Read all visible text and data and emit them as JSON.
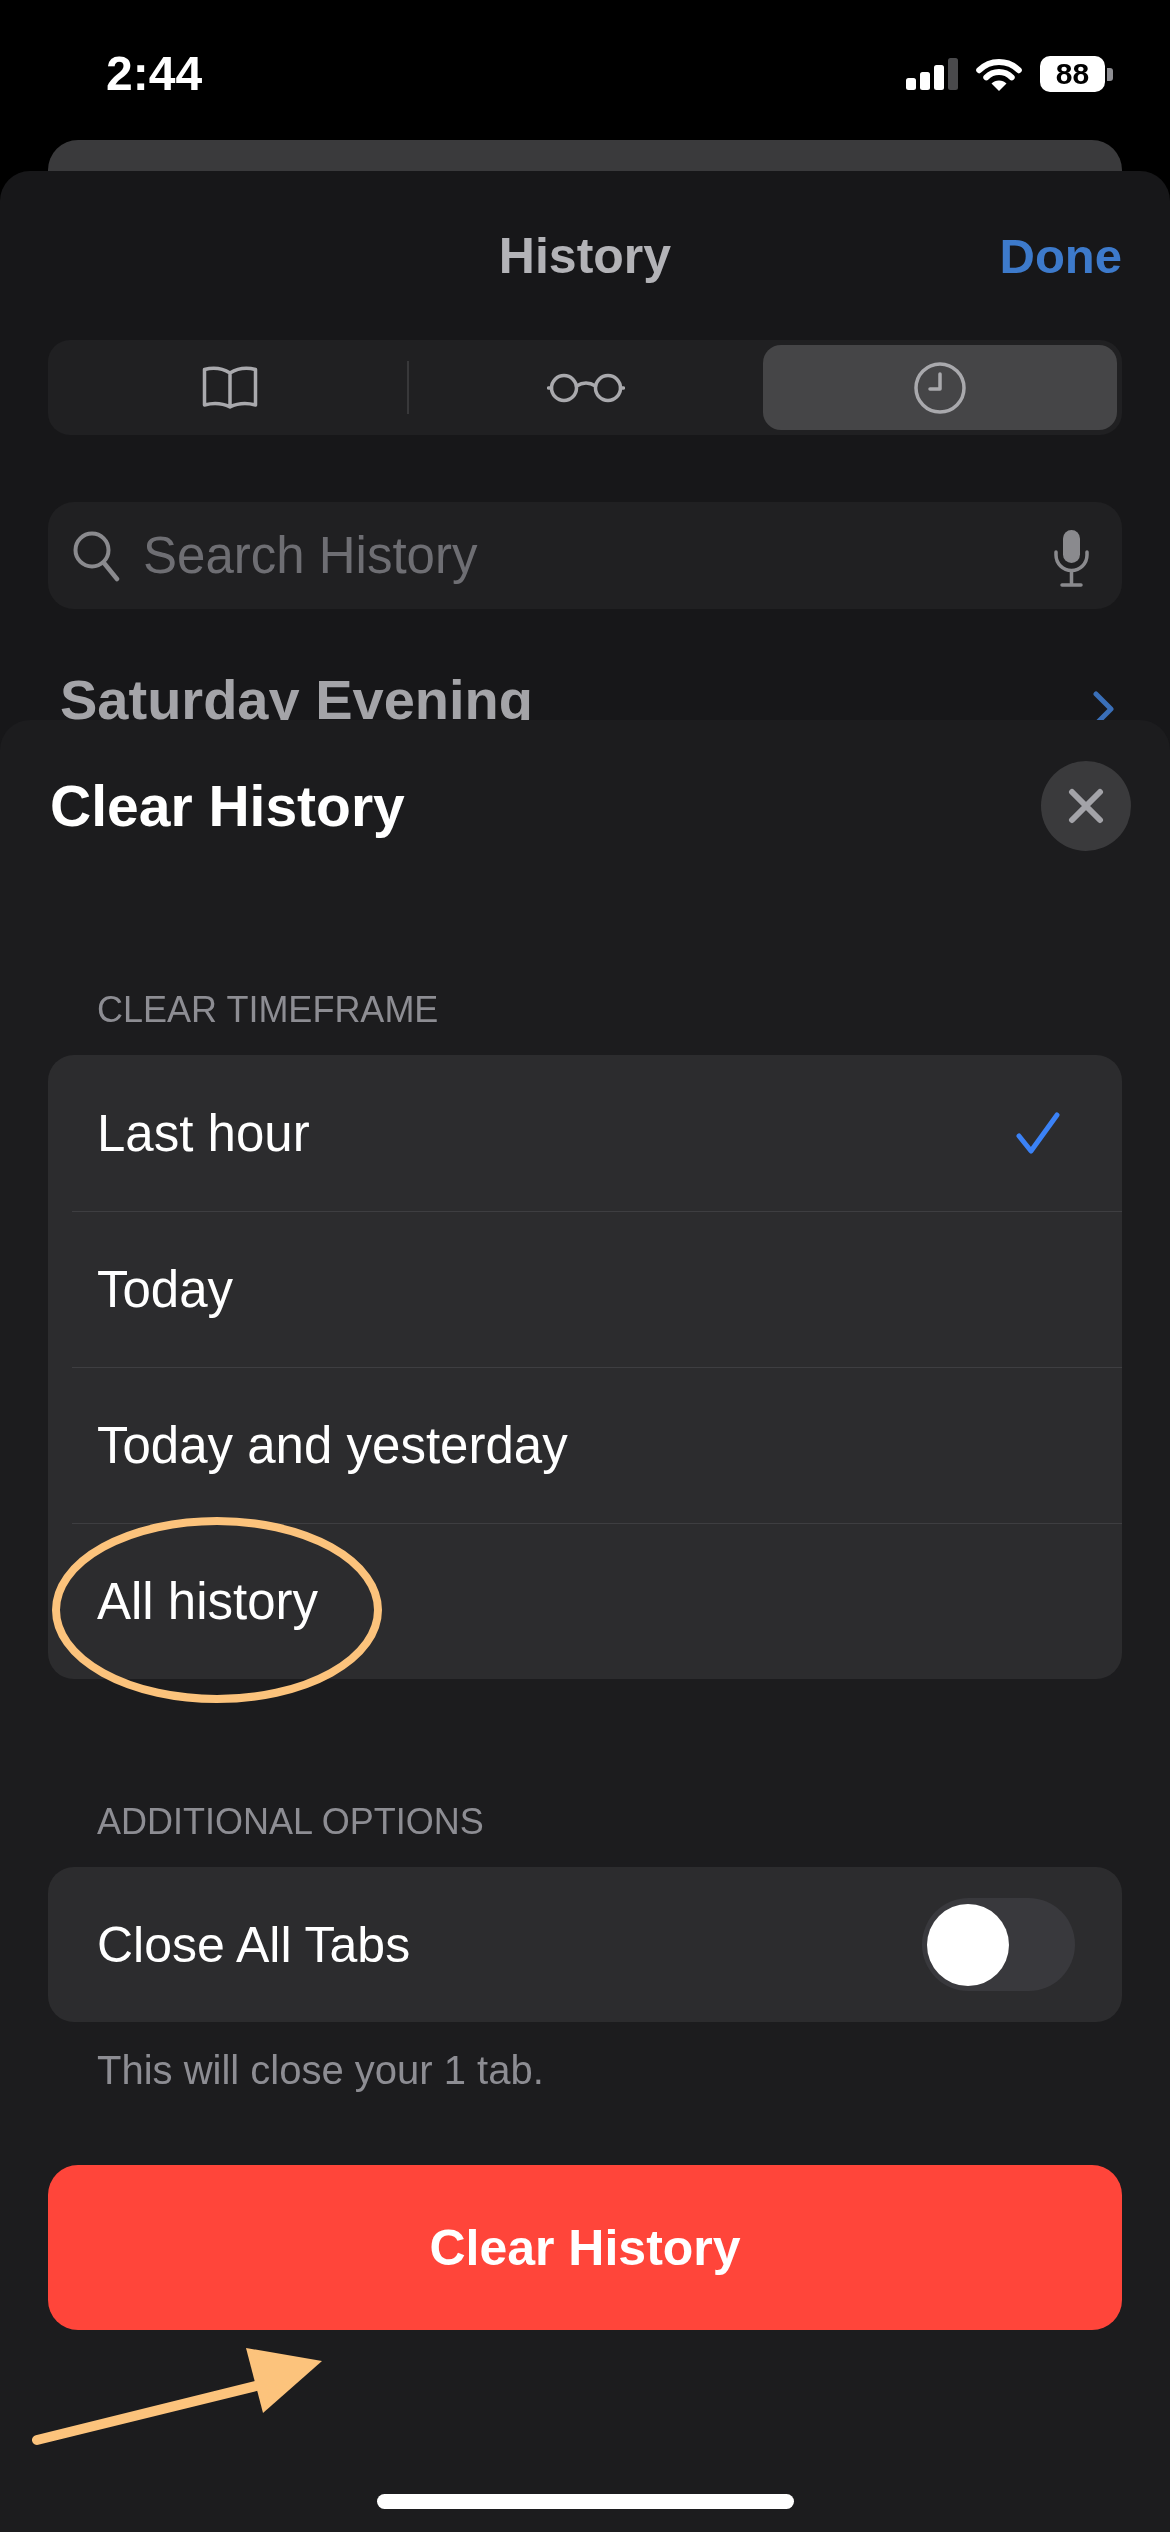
{
  "status_bar": {
    "time": "2:44",
    "battery": "88"
  },
  "history_sheet": {
    "title": "History",
    "done": "Done",
    "tabs": [
      {
        "kind": "bookmarks",
        "selected": false
      },
      {
        "kind": "reading_list",
        "selected": false
      },
      {
        "kind": "history",
        "selected": true
      }
    ],
    "search": {
      "placeholder": "Search History"
    },
    "section": "Saturday Evening"
  },
  "clear_sheet": {
    "title": "Clear History",
    "timeframe": {
      "header": "CLEAR TIMEFRAME",
      "options": [
        {
          "label": "Last hour",
          "selected": true,
          "circled": false
        },
        {
          "label": "Today",
          "selected": false,
          "circled": false
        },
        {
          "label": "Today and yesterday",
          "selected": false,
          "circled": false
        },
        {
          "label": "All history",
          "selected": false,
          "circled": true
        }
      ]
    },
    "additional_options": {
      "header": "ADDITIONAL OPTIONS",
      "items": [
        {
          "label": "Close All Tabs",
          "on": false
        }
      ],
      "footer": "This will close your 1 tab."
    },
    "button": {
      "label": "Clear History",
      "arrow": true
    }
  }
}
